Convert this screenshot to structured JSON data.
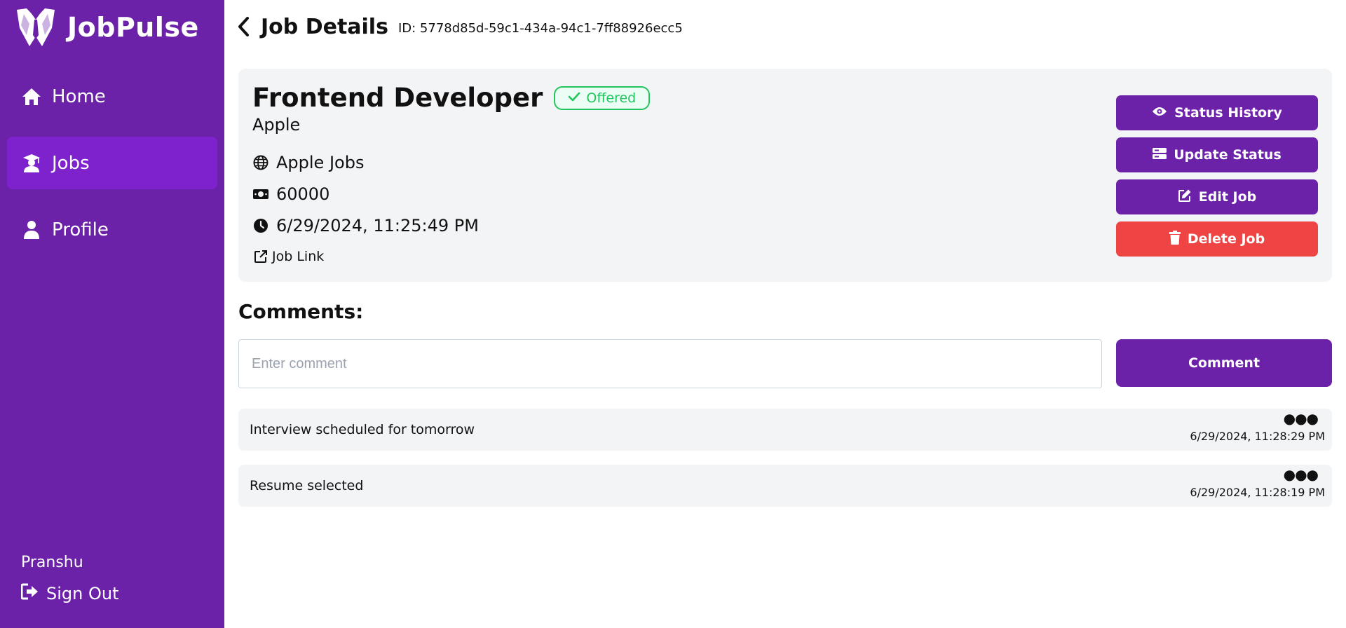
{
  "app": {
    "name": "JobPulse"
  },
  "sidebar": {
    "items": [
      {
        "label": "Home",
        "icon": "home-icon"
      },
      {
        "label": "Jobs",
        "icon": "graduate-icon"
      },
      {
        "label": "Profile",
        "icon": "user-icon"
      }
    ],
    "active": "Jobs",
    "user_name": "Pranshu",
    "signout_label": "Sign Out"
  },
  "header": {
    "title": "Job Details",
    "id_text": "ID: 5778d85d-59c1-434a-94c1-7ff88926ecc5"
  },
  "job": {
    "title": "Frontend Developer",
    "status": "Offered",
    "company": "Apple",
    "source": "Apple Jobs",
    "salary": "60000",
    "date": "6/29/2024, 11:25:49 PM",
    "link_label": "Job Link"
  },
  "actions": {
    "status_history": "Status History",
    "update_status": "Update Status",
    "edit_job": "Edit Job",
    "delete_job": "Delete Job"
  },
  "comments": {
    "title": "Comments:",
    "placeholder": "Enter comment",
    "button_label": "Comment",
    "items": [
      {
        "text": "Interview scheduled for tomorrow",
        "time": "6/29/2024, 11:28:29 PM"
      },
      {
        "text": "Resume selected",
        "time": "6/29/2024, 11:28:19 PM"
      }
    ]
  },
  "colors": {
    "primary": "#6b21a8",
    "sidebar_active": "#7e22ce",
    "danger": "#ef4444",
    "success": "#22c55e",
    "card_bg": "#f3f4f6"
  }
}
